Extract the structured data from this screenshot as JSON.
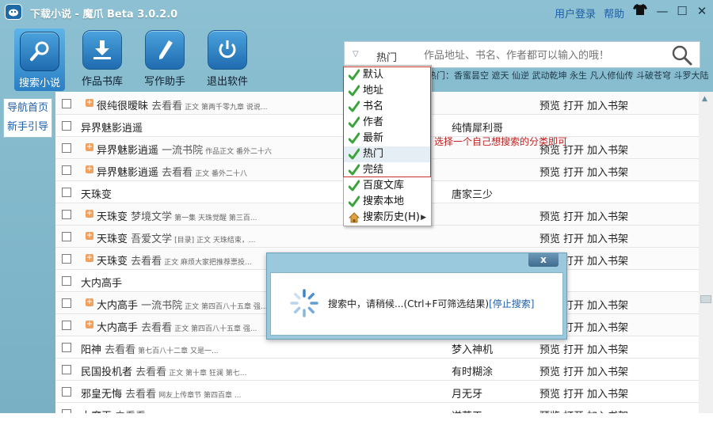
{
  "app": {
    "title": "下载小说 - 魔爪  Beta 3.0.2.0"
  },
  "top_links": {
    "login": "用户登录",
    "help": "帮助"
  },
  "window_controls": {
    "skin": "shirt-icon",
    "minimize": "—",
    "maximize": "☐",
    "close": "✕"
  },
  "toolbar": [
    {
      "label": "搜索小说",
      "icon": "search-icon",
      "active": true
    },
    {
      "label": "作品书库",
      "icon": "download-icon",
      "active": false
    },
    {
      "label": "写作助手",
      "icon": "pen-icon",
      "active": false
    },
    {
      "label": "退出软件",
      "icon": "power-icon",
      "active": false
    }
  ],
  "search": {
    "category": "热门",
    "placeholder": "作品地址、书名、作者都可以输入的哦！",
    "hot_list": "热门：香蜜昙空 遮天 仙逆 武动乾坤 永生 凡人修仙传 斗破苍穹 斗罗大陆"
  },
  "left_nav": {
    "home": "导航首页",
    "guide": "新手引导"
  },
  "dropdown": {
    "items": [
      {
        "label": "默认",
        "checked": true
      },
      {
        "label": "地址",
        "checked": true
      },
      {
        "label": "书名",
        "checked": true
      },
      {
        "label": "作者",
        "checked": true
      },
      {
        "label": "最新",
        "checked": true
      },
      {
        "label": "热门",
        "checked": true,
        "highlight": true
      },
      {
        "label": "完结",
        "checked": true
      },
      {
        "label": "百度文库",
        "checked": true
      },
      {
        "label": "搜索本地",
        "checked": true
      },
      {
        "label": "搜索历史(H)",
        "checked": false,
        "submenu": true
      }
    ],
    "hint": "选择一个自己想搜索的分类即可"
  },
  "results": [
    {
      "sub": true,
      "title": "很纯很暧昧",
      "source": "去看看",
      "excerpt": "正文 第两千零九章 说说...",
      "author": "",
      "actions": true
    },
    {
      "sub": false,
      "title": "异界魅影逍遥",
      "source": "",
      "excerpt": "",
      "author": "纯情犀利哥",
      "actions": false
    },
    {
      "sub": true,
      "title": "异界魅影逍遥",
      "source": "一流书院",
      "excerpt": "作品正文 番外二十六",
      "author": "",
      "actions": true
    },
    {
      "sub": true,
      "title": "异界魅影逍遥",
      "source": "去看看",
      "excerpt": "正文 番外二十八",
      "author": "",
      "actions": true
    },
    {
      "sub": false,
      "title": "天珠变",
      "source": "",
      "excerpt": "",
      "author": "唐家三少",
      "actions": false
    },
    {
      "sub": true,
      "title": "天珠变",
      "source": "梦境文学",
      "excerpt": "第一集 天珠觉醒 第三百...",
      "author": "",
      "actions": true
    },
    {
      "sub": true,
      "title": "天珠变",
      "source": "吾爱文学",
      "excerpt": "[目录] 正文 天珠结束，...",
      "author": "",
      "actions": true
    },
    {
      "sub": true,
      "title": "天珠变",
      "source": "去看看",
      "excerpt": "正文 麻烦大家把推荐票投...",
      "author": "",
      "actions": true
    },
    {
      "sub": false,
      "title": "大内高手",
      "source": "",
      "excerpt": "",
      "author": "",
      "actions": false
    },
    {
      "sub": true,
      "title": "大内高手",
      "source": "一流书院",
      "excerpt": "正文 第四百八十五章 强...",
      "author": "",
      "actions": true
    },
    {
      "sub": true,
      "title": "大内高手",
      "source": "去看看",
      "excerpt": "正文 第四百八十五章 强...",
      "author": "",
      "actions": true
    },
    {
      "sub": false,
      "title": "阳神",
      "source": "去看看",
      "excerpt": "第七百八十二章 又是一...",
      "author": "梦入神机",
      "actions": true
    },
    {
      "sub": false,
      "title": "民国投机者",
      "source": "去看看",
      "excerpt": "正文 第十章 狂澜 第七...",
      "author": "有时糊涂",
      "actions": true
    },
    {
      "sub": false,
      "title": "邪皇无悔",
      "source": "去看看",
      "excerpt": "网友上传章节 第四百章 ...",
      "author": "月无牙",
      "actions": true
    },
    {
      "sub": false,
      "title": "大魔王",
      "source": "去看看",
      "excerpt": "正文 总结和新书...",
      "author": "逆苍天",
      "actions": true
    }
  ],
  "row_actions": {
    "preview": "预览",
    "open": "打开",
    "add": "加入书架"
  },
  "dialog": {
    "close": "x",
    "message": "搜索中，请稍候...(Ctrl+F可筛选结果)",
    "stop": "[停止搜索]"
  }
}
